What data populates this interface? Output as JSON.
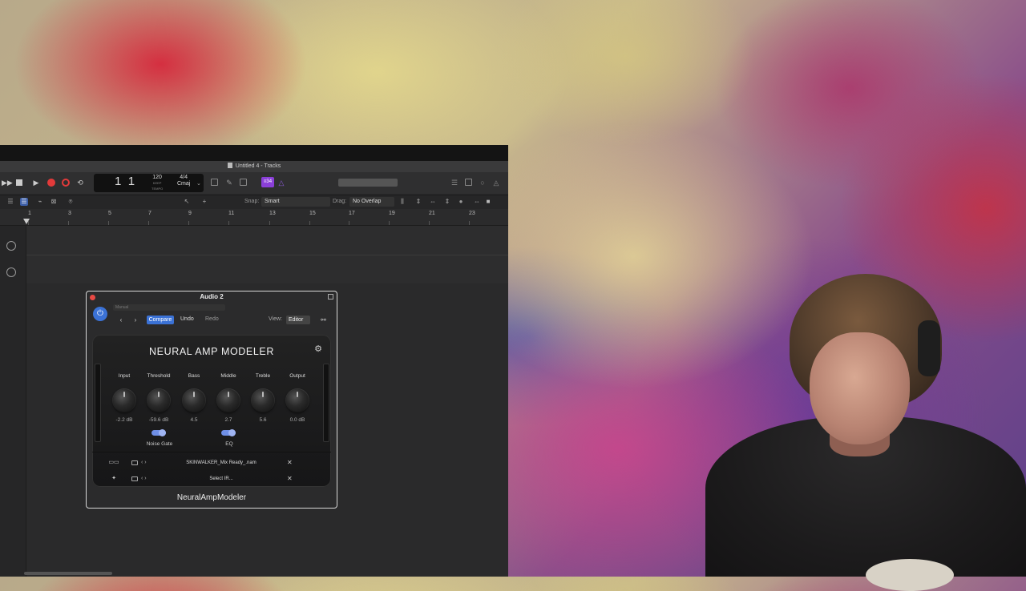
{
  "daw": {
    "window_title": "Untitled 4 - Tracks",
    "lcd": {
      "position_bar": "1",
      "position_beat": "1",
      "bar_label": "BAR",
      "beat_label": "BEAT",
      "tempo": "120",
      "tempo_sub": "KEEP",
      "tempo_label": "TEMPO",
      "time_signature": "4/4",
      "key": "Cmaj"
    },
    "plugin_badge": "≡34",
    "snap_label": "Snap:",
    "snap_value": "Smart",
    "drag_label": "Drag:",
    "drag_value": "No Overlap",
    "ruler_numbers": [
      "1",
      "3",
      "5",
      "7",
      "9",
      "11",
      "13",
      "15",
      "17",
      "19",
      "21",
      "23"
    ]
  },
  "plugin": {
    "window_title": "Audio 2",
    "preset": "Manual",
    "compare_label": "Compare",
    "undo_label": "Undo",
    "redo_label": "Redo",
    "view_label": "View:",
    "view_value": "Editor",
    "nam_title": "NEURAL AMP MODELER",
    "knobs": [
      {
        "label": "Input",
        "value": "-2.2 dB"
      },
      {
        "label": "Threshold",
        "value": "-59.6 dB"
      },
      {
        "label": "Bass",
        "value": "4.5"
      },
      {
        "label": "Middle",
        "value": "2.7"
      },
      {
        "label": "Treble",
        "value": "5.6"
      },
      {
        "label": "Output",
        "value": "0.0 dB"
      }
    ],
    "toggles": [
      {
        "label": "Noise Gate",
        "on": true
      },
      {
        "label": "EQ",
        "on": true
      }
    ],
    "model_file": "SKINWALKER_Mix Ready_.nam",
    "ir_file": "Select IR...",
    "footer": "NeuralAmpModeler"
  }
}
